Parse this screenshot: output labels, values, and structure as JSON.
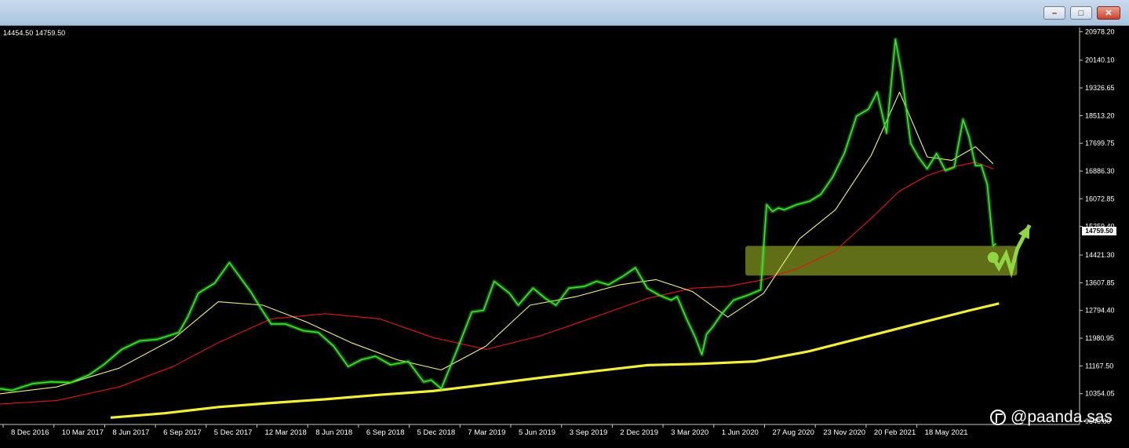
{
  "window": {
    "minimize_glyph": "–",
    "maximize_glyph": "□",
    "close_glyph": "✕"
  },
  "ohlc_readout": "14454.50 14759.50",
  "current_price": "14759.50",
  "watermark": {
    "icon": "pandas-logo-icon",
    "text": "@paanda.sas"
  },
  "colors": {
    "price": "#39e62c",
    "ma_short": "#f2f07a",
    "ma_mid": "#e01616",
    "ma_long": "#f3ee3c",
    "zone": "#7b8d1d",
    "arrow": "#8fd641"
  },
  "chart_data": {
    "type": "line",
    "title": "",
    "xlabel": "",
    "ylabel": "",
    "x_axis": {
      "tick_labels": [
        "8 Dec 2016",
        "10 Mar 2017",
        "8 Jun 2017",
        "6 Sep 2017",
        "5 Dec 2017",
        "12 Mar 2018",
        "8 Jun 2018",
        "6 Sep 2018",
        "5 Dec 2018",
        "7 Mar 2019",
        "5 Jun 2019",
        "3 Sep 2019",
        "2 Dec 2019",
        "3 Mar 2020",
        "1 Jun 2020",
        "27 Aug 2020",
        "23 Nov 2020",
        "20 Feb 2021",
        "18 May 2021"
      ]
    },
    "y_axis": {
      "position": "right",
      "range": [
        9450,
        21100
      ],
      "tick_labels": [
        "20978.20",
        "20140.10",
        "19326.65",
        "18513.20",
        "17699.75",
        "16886.30",
        "16072.85",
        "15259.40",
        "14421.30",
        "13607.85",
        "12794.40",
        "11980.95",
        "11167.50",
        "10354.05",
        "9540.60"
      ],
      "tick_values": [
        20978.2,
        20140.1,
        19326.65,
        18513.2,
        17699.75,
        16886.3,
        16072.85,
        15259.4,
        14421.3,
        13607.85,
        12794.4,
        11980.95,
        11167.5,
        10354.05,
        9540.6
      ]
    },
    "grid": false,
    "series": [
      {
        "key": "price",
        "color": "#39e62c",
        "x": [
          "2016-11-25",
          "2016-12-15",
          "2017-01-20",
          "2017-02-20",
          "2017-03-25",
          "2017-04-25",
          "2017-05-20",
          "2017-06-20",
          "2017-07-20",
          "2017-08-20",
          "2017-09-25",
          "2017-10-10",
          "2017-10-28",
          "2017-11-25",
          "2017-12-20",
          "2018-01-10",
          "2018-01-25",
          "2018-02-10",
          "2018-03-01",
          "2018-03-25",
          "2018-04-25",
          "2018-05-20",
          "2018-06-15",
          "2018-07-10",
          "2018-08-01",
          "2018-08-25",
          "2018-09-20",
          "2018-10-20",
          "2018-11-15",
          "2018-11-28",
          "2018-12-15",
          "2019-01-10",
          "2019-02-05",
          "2019-02-25",
          "2019-03-15",
          "2019-04-10",
          "2019-04-25",
          "2019-05-20",
          "2019-06-10",
          "2019-06-28",
          "2019-07-20",
          "2019-08-15",
          "2019-09-05",
          "2019-09-25",
          "2019-10-20",
          "2019-11-10",
          "2019-11-30",
          "2019-12-20",
          "2020-01-10",
          "2020-01-20",
          "2020-02-05",
          "2020-02-20",
          "2020-03-02",
          "2020-03-10",
          "2020-03-20",
          "2020-04-05",
          "2020-04-25",
          "2020-05-20",
          "2020-06-10",
          "2020-06-20",
          "2020-06-30",
          "2020-07-10",
          "2020-07-20",
          "2020-08-10",
          "2020-09-01",
          "2020-09-20",
          "2020-10-10",
          "2020-10-30",
          "2020-11-20",
          "2020-12-10",
          "2020-12-25",
          "2021-01-10",
          "2021-01-25",
          "2021-02-05",
          "2021-02-20",
          "2021-03-05",
          "2021-03-20",
          "2021-04-05",
          "2021-04-20",
          "2021-05-05",
          "2021-05-20",
          "2021-05-30",
          "2021-06-10",
          "2021-06-20",
          "2021-06-30",
          "2021-07-10",
          "2021-07-15"
        ],
        "values": [
          10500,
          10450,
          10650,
          10700,
          10680,
          10900,
          11200,
          11650,
          11900,
          11950,
          12150,
          12600,
          13300,
          13600,
          14200,
          13700,
          13350,
          12900,
          12400,
          12400,
          12200,
          12150,
          11750,
          11150,
          11350,
          11450,
          11200,
          11300,
          10700,
          10750,
          10500,
          11600,
          12750,
          12800,
          13650,
          13300,
          12950,
          13450,
          13150,
          12950,
          13450,
          13500,
          13650,
          13550,
          13800,
          14050,
          13450,
          13250,
          13100,
          13200,
          12550,
          12000,
          11500,
          12100,
          12300,
          12700,
          13100,
          13250,
          13400,
          15900,
          15700,
          15800,
          15750,
          15900,
          16000,
          16200,
          16700,
          17400,
          18500,
          18700,
          19200,
          18000,
          20750,
          19700,
          17700,
          17300,
          16950,
          17400,
          16900,
          17000,
          18400,
          17900,
          17050,
          17050,
          16500,
          14700,
          14759.5
        ]
      },
      {
        "key": "ma_short",
        "color": "#f2f07a",
        "x": [
          "2016-11-25",
          "2017-03-01",
          "2017-06-15",
          "2017-09-15",
          "2017-12-01",
          "2018-02-15",
          "2018-05-01",
          "2018-07-15",
          "2018-10-01",
          "2018-12-15",
          "2019-03-01",
          "2019-05-15",
          "2019-08-01",
          "2019-10-15",
          "2019-12-15",
          "2020-02-15",
          "2020-04-15",
          "2020-06-15",
          "2020-08-15",
          "2020-10-15",
          "2020-12-15",
          "2021-02-01",
          "2021-03-20",
          "2021-05-01",
          "2021-06-10",
          "2021-07-10"
        ],
        "values": [
          10350,
          10550,
          11100,
          11950,
          13050,
          12950,
          12450,
          11850,
          11350,
          11050,
          11750,
          12950,
          13200,
          13550,
          13700,
          13350,
          12600,
          13300,
          14900,
          15750,
          17350,
          19200,
          17300,
          17200,
          17600,
          17100
        ]
      },
      {
        "key": "ma_mid",
        "color": "#e01616",
        "x": [
          "2016-11-25",
          "2017-03-01",
          "2017-06-15",
          "2017-09-15",
          "2017-12-01",
          "2018-03-01",
          "2018-06-01",
          "2018-09-01",
          "2018-12-01",
          "2019-03-01",
          "2019-06-01",
          "2019-09-01",
          "2019-12-01",
          "2020-02-15",
          "2020-04-15",
          "2020-06-15",
          "2020-08-15",
          "2020-10-15",
          "2020-12-15",
          "2021-02-01",
          "2021-03-20",
          "2021-05-01",
          "2021-06-10",
          "2021-07-10"
        ],
        "values": [
          10050,
          10150,
          10550,
          11150,
          11850,
          12550,
          12700,
          12550,
          12000,
          11650,
          12050,
          12600,
          13150,
          13450,
          13500,
          13700,
          14050,
          14550,
          15500,
          16300,
          16750,
          17000,
          17150,
          16950
        ]
      },
      {
        "key": "ma_long",
        "color": "#f3ee3c",
        "x": [
          "2017-06-01",
          "2017-09-01",
          "2017-12-01",
          "2018-03-01",
          "2018-06-01",
          "2018-09-01",
          "2018-12-01",
          "2019-03-01",
          "2019-06-01",
          "2019-09-01",
          "2019-12-01",
          "2020-03-01",
          "2020-06-01",
          "2020-09-01",
          "2020-12-01",
          "2021-03-01",
          "2021-06-01",
          "2021-07-20"
        ],
        "values": [
          9650,
          9780,
          9960,
          10080,
          10190,
          10320,
          10430,
          10620,
          10820,
          11010,
          11190,
          11230,
          11300,
          11600,
          12000,
          12400,
          12800,
          13000
        ]
      }
    ],
    "annotations": [
      {
        "type": "zone",
        "x_range": [
          "2020-05-15",
          "2021-08-20"
        ],
        "y_range": [
          13820,
          14690
        ],
        "color": "#7b8d1d"
      },
      {
        "type": "marker",
        "x": "2021-07-10",
        "y": 14350,
        "color": "#8fd641"
      },
      {
        "type": "forecast-arrow",
        "x": [
          "2021-07-10",
          "2021-07-20",
          "2021-08-01",
          "2021-08-10",
          "2021-08-20",
          "2021-09-10"
        ],
        "y": [
          14350,
          14050,
          14450,
          13950,
          14600,
          15300
        ],
        "color": "#8fd641"
      }
    ]
  }
}
